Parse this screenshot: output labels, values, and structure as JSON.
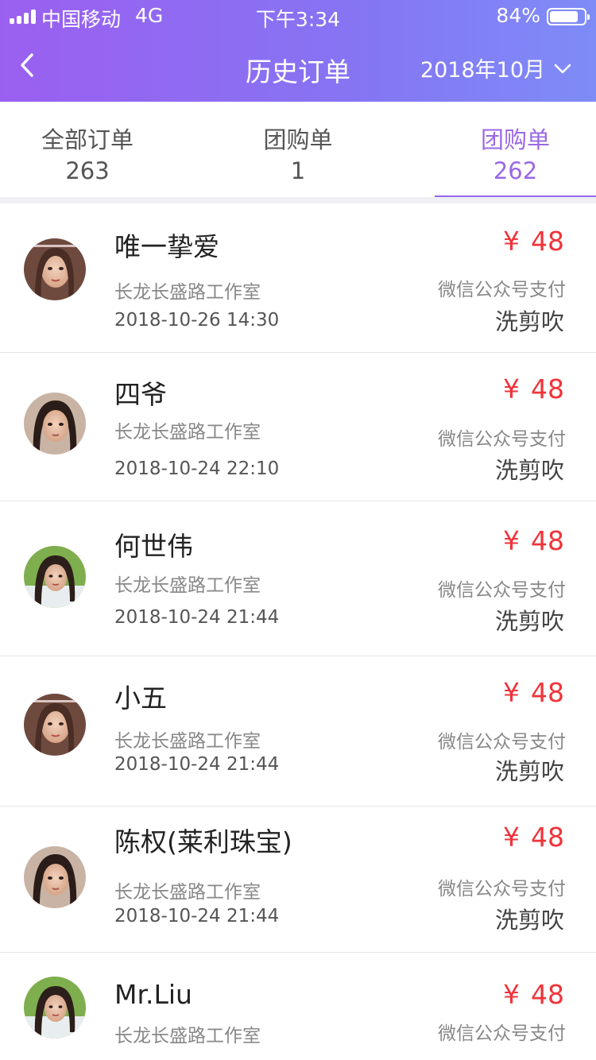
{
  "status_bar": {
    "carrier": "中国移动",
    "network": "4G",
    "time": "下午3:34",
    "battery": "84%",
    "battery_level": 0.84
  },
  "nav": {
    "back_icon": "chevron-left-icon",
    "title": "历史订单",
    "month": "2018年10月",
    "month_dropdown_icon": "chevron-down-icon"
  },
  "tabs": [
    {
      "label": "全部订单",
      "count": "263",
      "active": false
    },
    {
      "label": "团购单",
      "count": "1",
      "active": false
    },
    {
      "label": "团购单",
      "count": "262",
      "active": true
    }
  ],
  "orders": [
    {
      "name": "唯一挚爱",
      "store": "长龙长盛路工作室",
      "time": "2018-10-26 14:30",
      "currency": "¥",
      "amount": "48",
      "payment": "微信公众号支付",
      "service": "洗剪吹",
      "avatar": "avatar-a"
    },
    {
      "name": "四爷",
      "store": "长龙长盛路工作室",
      "time": "2018-10-24 22:10",
      "currency": "¥",
      "amount": "48",
      "payment": "微信公众号支付",
      "service": "洗剪吹",
      "avatar": "avatar-b"
    },
    {
      "name": "何世伟",
      "store": "长龙长盛路工作室",
      "time": "2018-10-24 21:44",
      "currency": "¥",
      "amount": "48",
      "payment": "微信公众号支付",
      "service": "洗剪吹",
      "avatar": "avatar-c"
    },
    {
      "name": "小五",
      "store": "长龙长盛路工作室",
      "time": "2018-10-24 21:44",
      "currency": "¥",
      "amount": "48",
      "payment": "微信公众号支付",
      "service": "洗剪吹",
      "avatar": "avatar-a"
    },
    {
      "name": "陈权(莱利珠宝)",
      "store": "长龙长盛路工作室",
      "time": "2018-10-24 21:44",
      "currency": "¥",
      "amount": "48",
      "payment": "微信公众号支付",
      "service": "洗剪吹",
      "avatar": "avatar-b"
    },
    {
      "name": "Mr.Liu",
      "store": "长龙长盛路工作室",
      "currency": "¥",
      "amount": "48",
      "payment": "微信公众号支付",
      "avatar": "avatar-c"
    }
  ],
  "colors": {
    "header_gradient_start": "#9b5ff0",
    "header_gradient_end": "#7e8cf7",
    "active_tab": "#9a68e6",
    "price": "#f0343a"
  }
}
